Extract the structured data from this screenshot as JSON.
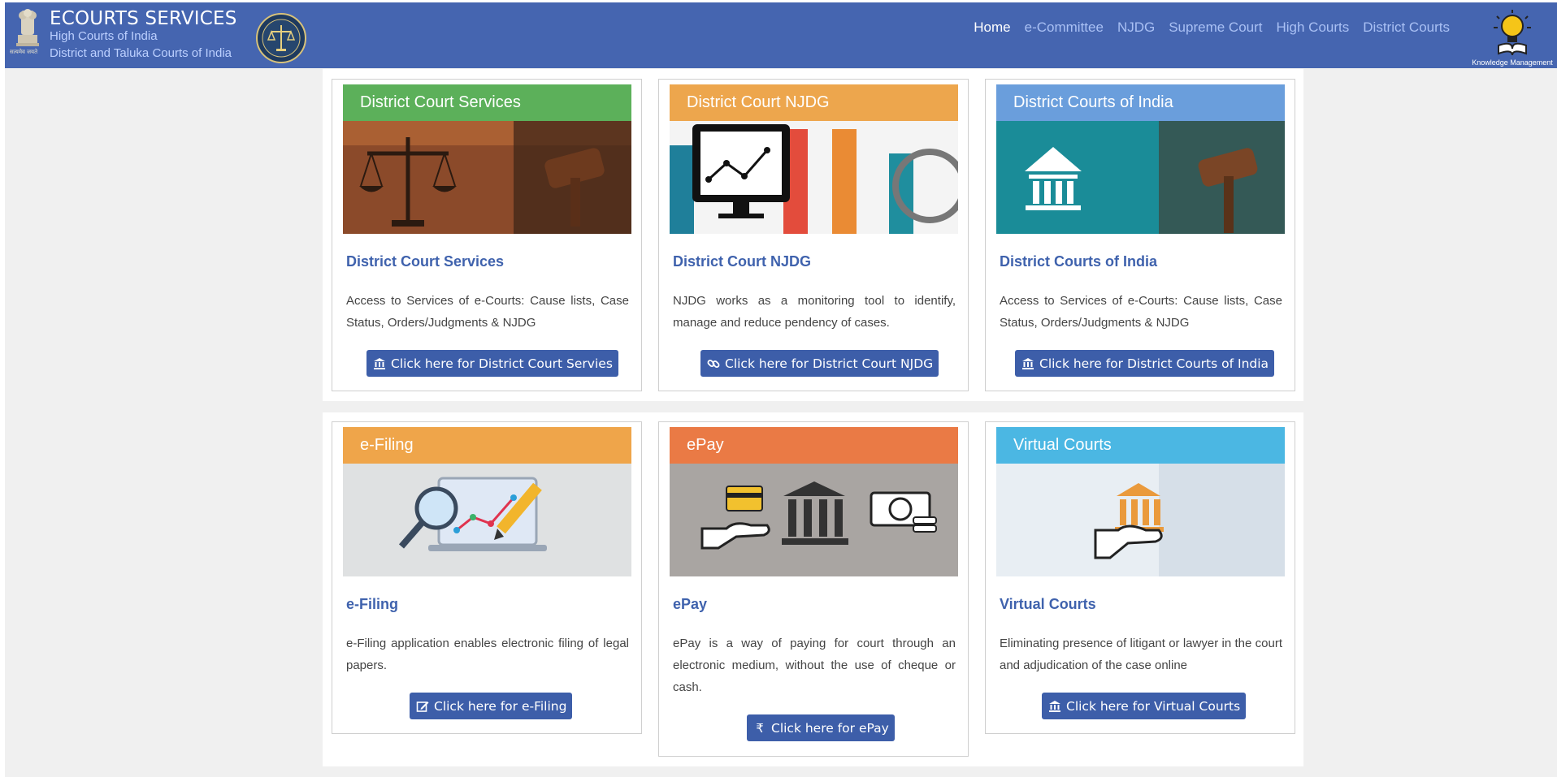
{
  "header": {
    "title": "ECOURTS SERVICES",
    "subtitle1": "High Courts of India",
    "subtitle2": "District and Taluka Courts of India",
    "emblem_caption": "सत्यमेव जयते",
    "km_label": "Knowledge Management"
  },
  "nav": [
    {
      "label": "Home",
      "active": true
    },
    {
      "label": "e-Committee"
    },
    {
      "label": "NJDG"
    },
    {
      "label": "Supreme Court"
    },
    {
      "label": "High Courts"
    },
    {
      "label": "District Courts"
    }
  ],
  "cards": [
    {
      "banner": "District Court Services",
      "title": "District Court Services",
      "desc": "Access to Services of e-Courts: Cause lists, Case Status, Orders/Judgments & NJDG",
      "button": "Click here for District Court Servies",
      "icon": "bank-icon",
      "color": "#5cb05a"
    },
    {
      "banner": "District Court NJDG",
      "title": "District Court NJDG",
      "desc": "NJDG works as a monitoring tool to identify, manage and reduce pendency of cases.",
      "button": "Click here for District Court NJDG",
      "icon": "link-icon",
      "color": "#eda64d"
    },
    {
      "banner": "District Courts of India",
      "title": "District Courts of India",
      "desc": "Access to Services of e-Courts: Cause lists, Case Status, Orders/Judgments & NJDG",
      "button": "Click here for District Courts of India",
      "icon": "bank-icon",
      "color": "#6a9edc"
    },
    {
      "banner": "e-Filing",
      "title": "e-Filing",
      "desc": "e-Filing application enables electronic filing of legal papers.",
      "button": "Click here for e-Filing",
      "icon": "edit-icon",
      "color": "#efa54a"
    },
    {
      "banner": "ePay",
      "title": "ePay",
      "desc": "ePay is a way of paying for court through an electronic medium, without the use of cheque or cash.",
      "button": "Click here for ePay",
      "icon": "rupee-icon",
      "color": "#ea7a45"
    },
    {
      "banner": "Virtual Courts",
      "title": "Virtual Courts",
      "desc": "Eliminating presence of litigant or lawyer in the court and adjudication of the case online",
      "button": "Click here for Virtual Courts",
      "icon": "bank-icon",
      "color": "#4bb7e3"
    }
  ]
}
